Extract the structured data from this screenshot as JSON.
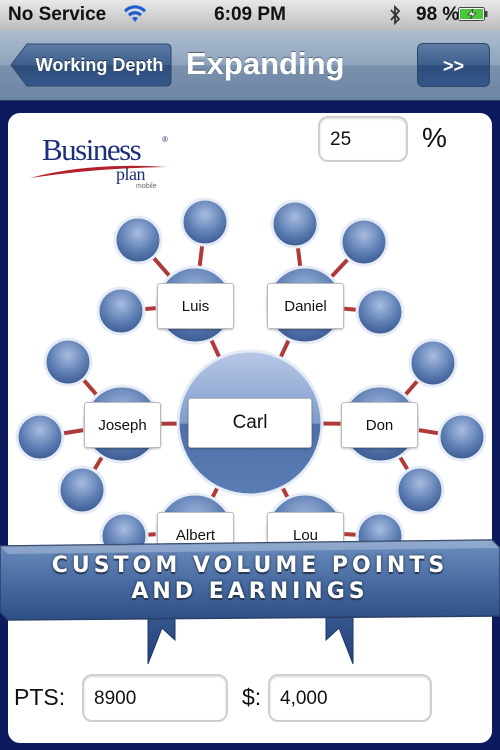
{
  "status_bar": {
    "carrier": "No Service",
    "time": "6:09 PM",
    "battery": "98 %"
  },
  "nav": {
    "back_label": "Working Depth",
    "title": "Expanding",
    "forward_label": ">>"
  },
  "logo": {
    "line1": "Business",
    "line2": "plan",
    "line3": "mobile",
    "mark": "®"
  },
  "percent": {
    "value": "25",
    "unit": "%"
  },
  "network": {
    "center": "Carl",
    "nodes": [
      "Luis",
      "Daniel",
      "Joseph",
      "Don",
      "Albert",
      "Lou"
    ]
  },
  "banner": {
    "line1": "CUSTOM VOLUME POINTS",
    "line2": "AND EARNINGS"
  },
  "totals": {
    "pts_label": "PTS:",
    "pts_value": "8900",
    "money_label": "$:",
    "money_value": "4,000"
  },
  "colors": {
    "frame": "#0d1a5e",
    "node": "#5e7fb4",
    "connector": "#b03a3a",
    "logo_blue": "#1c2f7d",
    "logo_red": "#b3202a"
  }
}
